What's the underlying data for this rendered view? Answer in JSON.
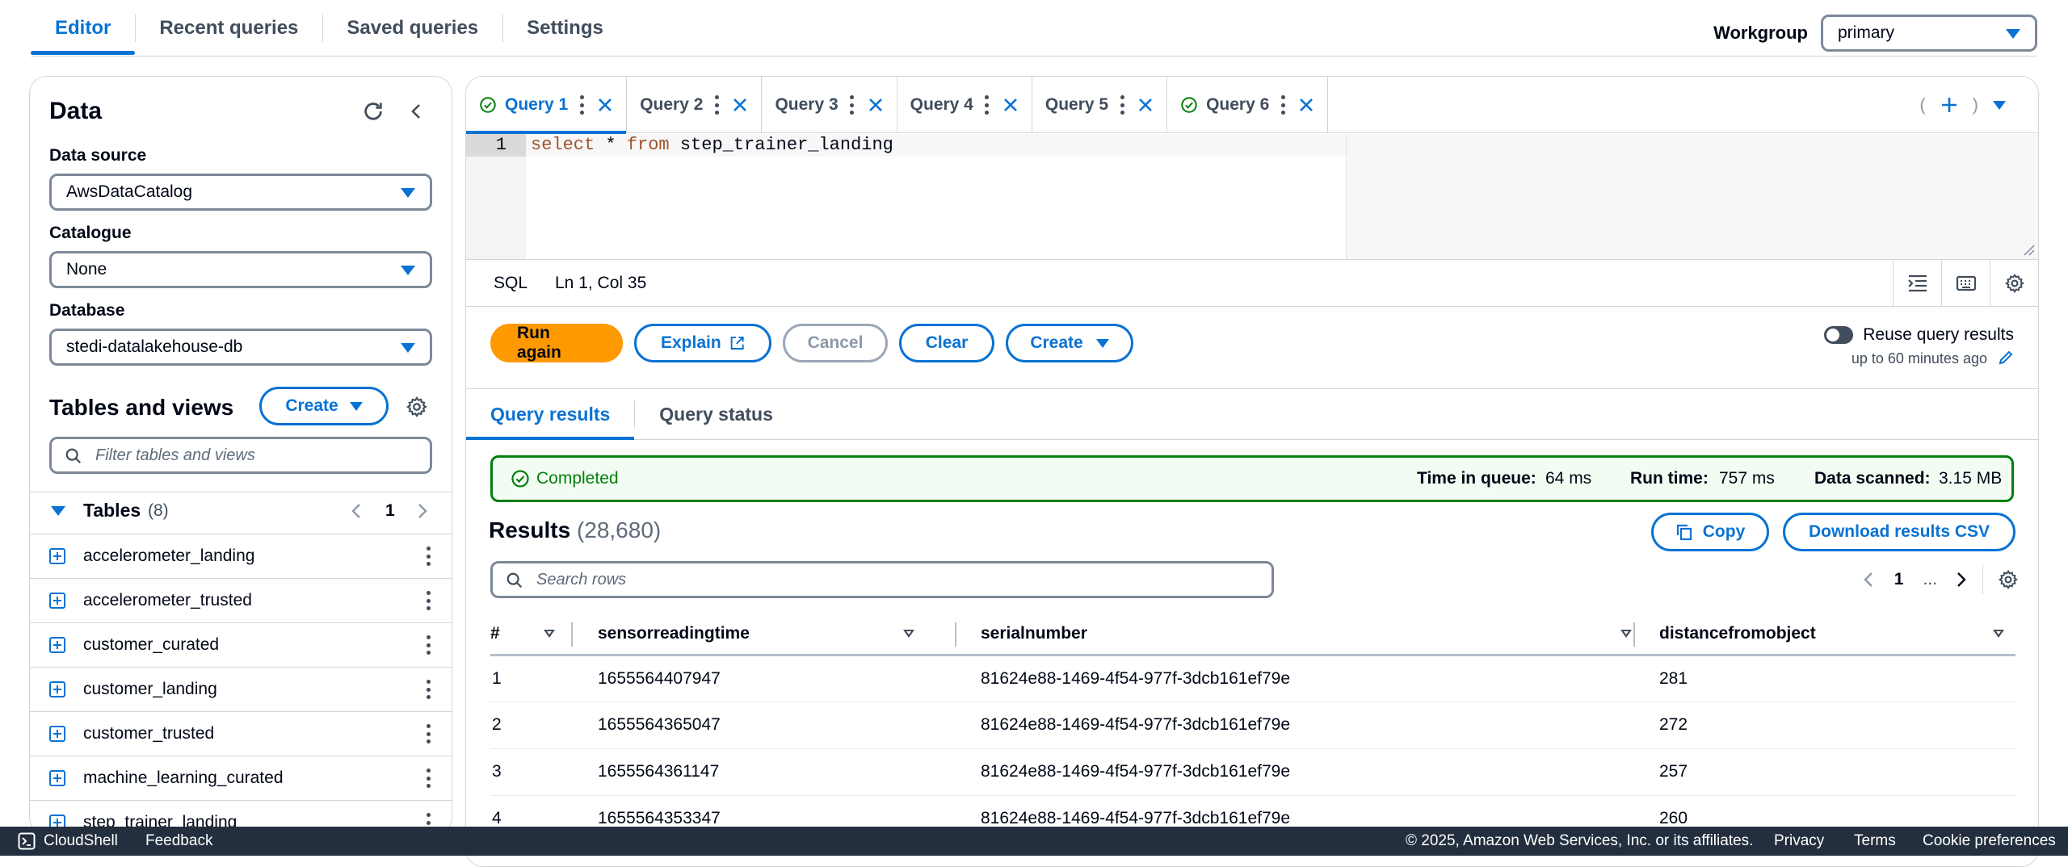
{
  "top_tabs": [
    "Editor",
    "Recent queries",
    "Saved queries",
    "Settings"
  ],
  "workgroup": {
    "label": "Workgroup",
    "value": "primary"
  },
  "data_panel": {
    "title": "Data",
    "data_source_label": "Data source",
    "data_source_value": "AwsDataCatalog",
    "catalogue_label": "Catalogue",
    "catalogue_value": "None",
    "database_label": "Database",
    "database_value": "stedi-datalakehouse-db",
    "tables_views_title": "Tables and views",
    "create_label": "Create",
    "filter_placeholder": "Filter tables and views",
    "tables_label": "Tables",
    "tables_count": "(8)",
    "tables_page": "1",
    "tables": [
      "accelerometer_landing",
      "accelerometer_trusted",
      "customer_curated",
      "customer_landing",
      "customer_trusted",
      "machine_learning_curated",
      "step_trainer_landing"
    ]
  },
  "query_tabs": [
    {
      "label": "Query 1",
      "status": "success"
    },
    {
      "label": "Query 2",
      "status": ""
    },
    {
      "label": "Query 3",
      "status": ""
    },
    {
      "label": "Query 4",
      "status": ""
    },
    {
      "label": "Query 5",
      "status": ""
    },
    {
      "label": "Query 6",
      "status": "success"
    }
  ],
  "editor": {
    "line_number": "1",
    "kw_select": "select",
    "star": " * ",
    "kw_from": "from",
    "table": " step_trainer_landing",
    "language": "SQL",
    "cursor": "Ln 1, Col 35"
  },
  "actions": {
    "run": "Run again",
    "explain": "Explain",
    "cancel": "Cancel",
    "clear": "Clear",
    "create": "Create",
    "reuse_label": "Reuse query results",
    "reuse_sub": "up to 60 minutes ago"
  },
  "results_tabs": [
    "Query results",
    "Query status"
  ],
  "status": {
    "state": "Completed",
    "queue_label": "Time in queue:",
    "queue_value": "64 ms",
    "run_label": "Run time:",
    "run_value": "757 ms",
    "scanned_label": "Data scanned:",
    "scanned_value": "3.15 MB"
  },
  "results": {
    "title": "Results",
    "count": "(28,680)",
    "copy": "Copy",
    "download": "Download results CSV",
    "search_placeholder": "Search rows",
    "page": "1",
    "ellipsis": "...",
    "columns": [
      "#",
      "sensorreadingtime",
      "serialnumber",
      "distancefromobject"
    ],
    "rows": [
      [
        "1",
        "1655564407947",
        "81624e88-1469-4f54-977f-3dcb161ef79e",
        "281"
      ],
      [
        "2",
        "1655564365047",
        "81624e88-1469-4f54-977f-3dcb161ef79e",
        "272"
      ],
      [
        "3",
        "1655564361147",
        "81624e88-1469-4f54-977f-3dcb161ef79e",
        "257"
      ],
      [
        "4",
        "1655564353347",
        "81624e88-1469-4f54-977f-3dcb161ef79e",
        "260"
      ]
    ]
  },
  "footer": {
    "cloudshell": "CloudShell",
    "feedback": "Feedback",
    "copyright": "© 2025, Amazon Web Services, Inc. or its affiliates.",
    "privacy": "Privacy",
    "terms": "Terms",
    "cookies": "Cookie preferences"
  },
  "colors": {
    "accent": "#0972d3",
    "primary_button": "#ff9900",
    "success": "#037f0c",
    "footer_bg": "#232f3e"
  }
}
